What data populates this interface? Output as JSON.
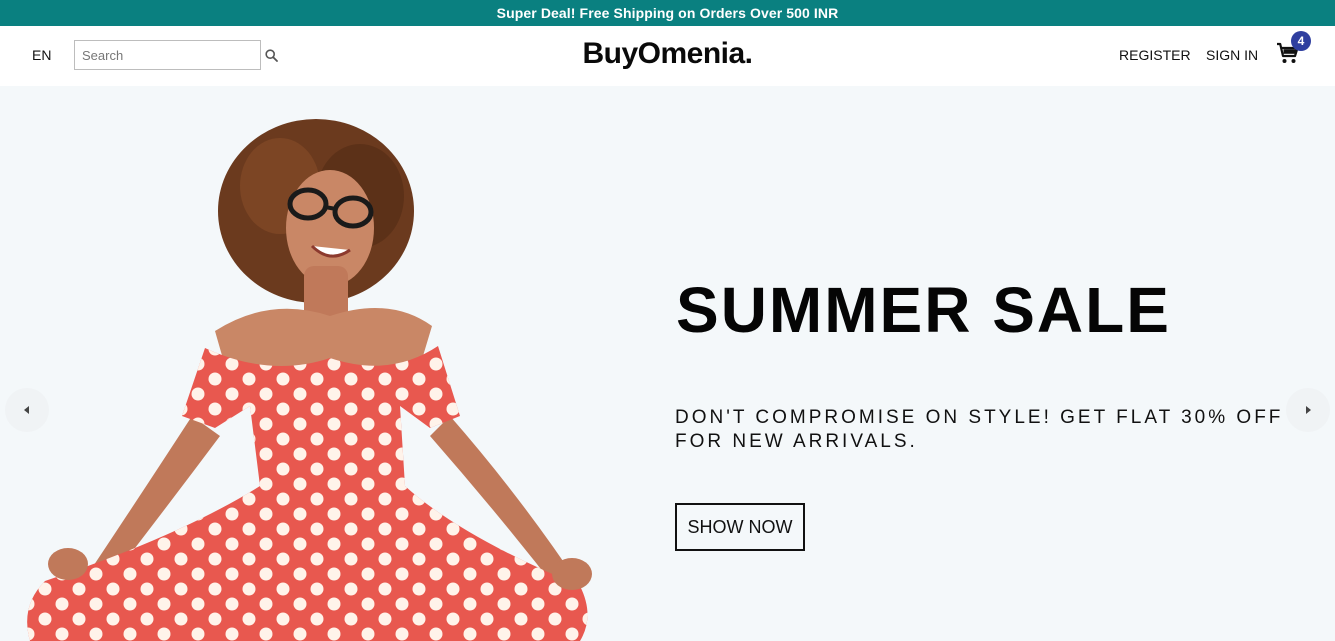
{
  "announcement": "Super Deal! Free Shipping on Orders Over 500 INR",
  "header": {
    "language": "EN",
    "search": {
      "placeholder": "Search",
      "value": ""
    },
    "logo": "BuyOmenia.",
    "register_label": "REGISTER",
    "signin_label": "SIGN IN",
    "cart_count": "4"
  },
  "hero": {
    "title": "SUMMER SALE",
    "subtitle": "DON'T COMPROMISE ON STYLE! GET FLAT 30% OFF FOR NEW ARRIVALS.",
    "cta_label": "SHOW NOW",
    "image_subject": "woman in red polka dot dress"
  },
  "icons": {
    "search": "search-icon",
    "cart": "cart-icon",
    "prev": "chevron-left-icon",
    "next": "chevron-right-icon"
  },
  "colors": {
    "announcement_bg": "#0a8080",
    "badge_bg": "#2f3f9f",
    "hero_bg": "#f4f8fa",
    "dress": "#e8584f"
  }
}
